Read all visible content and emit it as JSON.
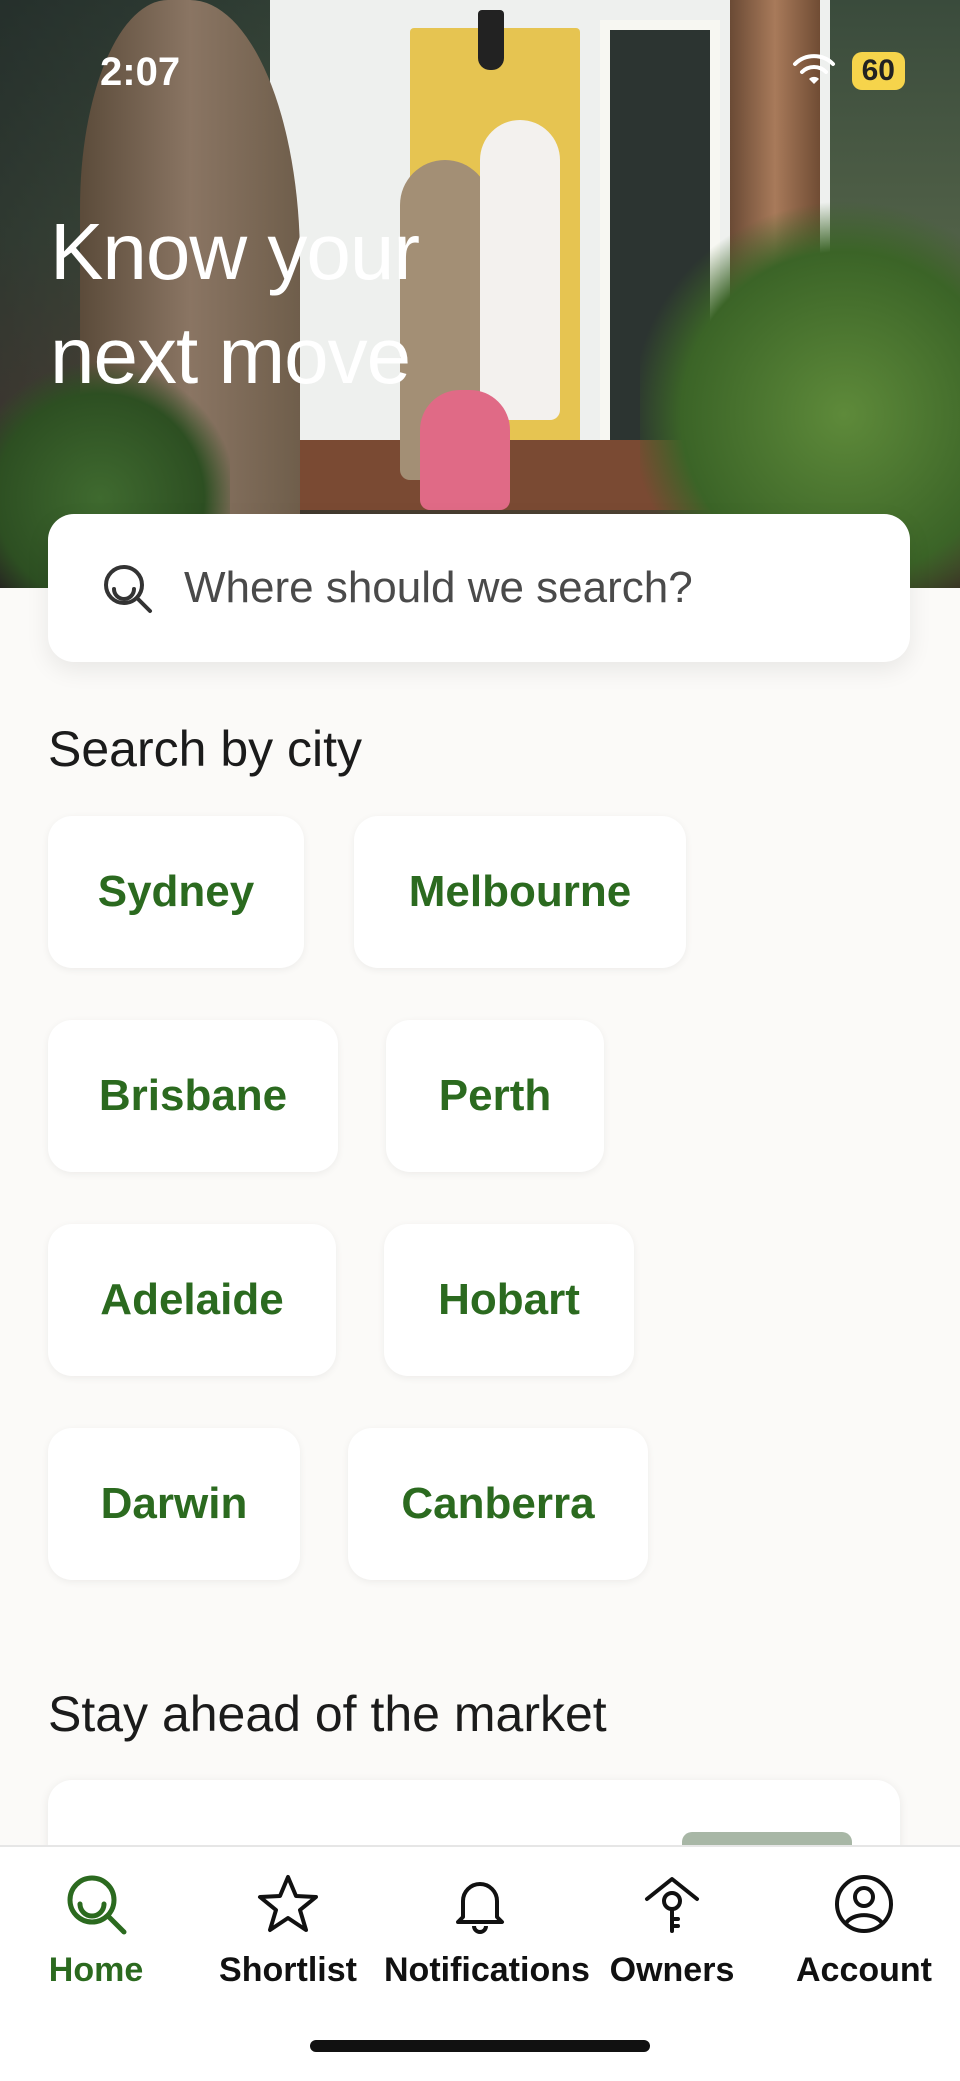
{
  "status_bar": {
    "time": "2:07",
    "battery": "60"
  },
  "hero": {
    "title_line1": "Know your",
    "title_line2": "next move"
  },
  "search": {
    "placeholder": "Where should we search?"
  },
  "cities": {
    "heading": "Search by city",
    "items": [
      "Sydney",
      "Melbourne",
      "Brisbane",
      "Perth",
      "Adelaide",
      "Hobart",
      "Darwin",
      "Canberra"
    ]
  },
  "market": {
    "heading": "Stay ahead of the market"
  },
  "tabbar": {
    "items": [
      {
        "label": "Home",
        "icon": "search-icon",
        "active": true
      },
      {
        "label": "Shortlist",
        "icon": "star-icon",
        "active": false
      },
      {
        "label": "Notifications",
        "icon": "bell-icon",
        "active": false
      },
      {
        "label": "Owners",
        "icon": "house-key-icon",
        "active": false
      },
      {
        "label": "Account",
        "icon": "user-circle-icon",
        "active": false
      }
    ]
  },
  "colors": {
    "accent": "#2b6a1f",
    "battery": "#f6d44b"
  }
}
